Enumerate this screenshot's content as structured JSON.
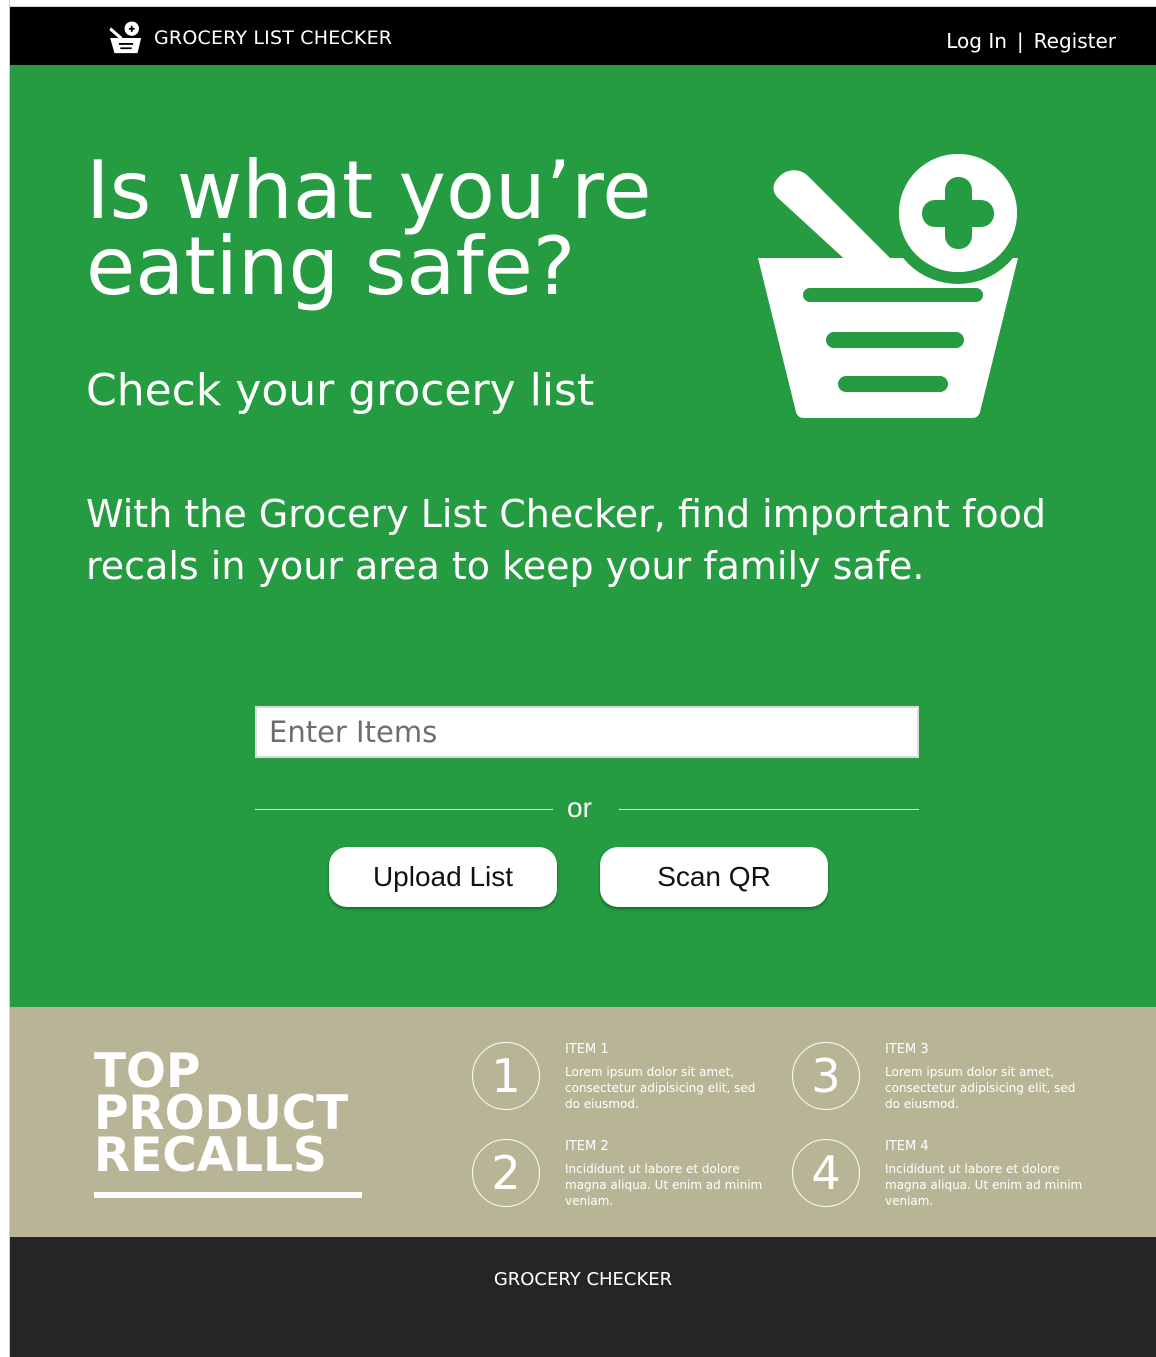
{
  "header": {
    "brand": "GROCERY LIST CHECKER",
    "login": "Log In",
    "separator": "|",
    "register": "Register"
  },
  "hero": {
    "title": "Is what you’re eating safe?",
    "subtitle": "Check your grocery list",
    "description": "With the Grocery List Checker, find important food recals in your area to keep your family safe.",
    "search_placeholder": "Enter Items",
    "or_text": "or",
    "upload_label": "Upload List",
    "scan_label": "Scan QR"
  },
  "recalls": {
    "title_line1": "TOP",
    "title_line2": "PRODUCT",
    "title_line3": "RECALLS",
    "items": [
      {
        "num": "1",
        "label": "ITEM 1",
        "text": "Lorem ipsum dolor sit amet, consectetur adipisicing elit, sed do eiusmod."
      },
      {
        "num": "2",
        "label": "ITEM 2",
        "text": "Incididunt ut labore et dolore magna aliqua. Ut enim ad minim veniam."
      },
      {
        "num": "3",
        "label": "ITEM 3",
        "text": "Lorem ipsum dolor sit amet, consectetur adipisicing elit, sed do eiusmod."
      },
      {
        "num": "4",
        "label": "ITEM 4",
        "text": "Incididunt ut labore et dolore magna aliqua. Ut enim ad minim veniam."
      }
    ]
  },
  "footer": {
    "text": "GROCERY CHECKER"
  },
  "colors": {
    "hero_green": "#259c41",
    "recalls_tan": "#b8b596",
    "topbar": "#000000",
    "footer": "#252525"
  },
  "icons": {
    "brand_logo": "basket-plus-icon",
    "hero_illustration": "basket-plus-icon"
  }
}
